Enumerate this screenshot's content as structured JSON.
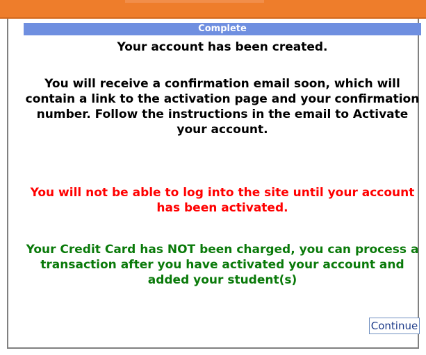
{
  "dialog": {
    "title": "Complete",
    "created_text": "Your account has been created.",
    "info_text": "You will receive a confirmation email soon, which will contain a link to the activation page and your confirmation number.  Follow the instructions in the email to Activate your account.",
    "warning_text": "You will not be able to log into the site until your account has been activated.",
    "credit_text": "Your Credit Card has NOT been charged, you can process a transaction after you have activated your account and added your student(s)",
    "continue_label": "Continue"
  },
  "colors": {
    "top_bar": "#ee7d2b",
    "title_bar": "#6f8fe0",
    "warning": "#ff0000",
    "credit": "#0a7a0a",
    "button_text": "#1f3d8a"
  }
}
